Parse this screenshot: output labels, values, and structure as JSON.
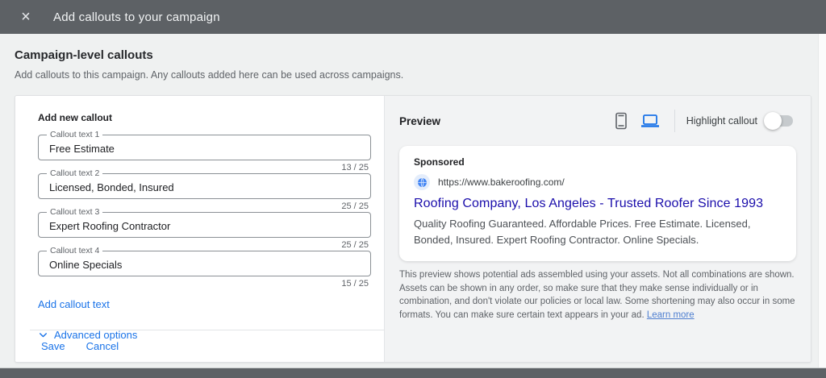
{
  "modal": {
    "title": "Add callouts to your campaign"
  },
  "page": {
    "heading": "Campaign-level callouts",
    "subheading": "Add callouts to this campaign. Any callouts added here can be used across campaigns."
  },
  "form": {
    "title": "Add new callout",
    "fields": [
      {
        "label": "Callout text 1",
        "value": "Free Estimate",
        "counter": "13 / 25"
      },
      {
        "label": "Callout text 2",
        "value": "Licensed, Bonded, Insured",
        "counter": "25 / 25"
      },
      {
        "label": "Callout text 3",
        "value": "Expert Roofing Contractor",
        "counter": "25 / 25"
      },
      {
        "label": "Callout text 4",
        "value": "Online Specials",
        "counter": "15 / 25"
      }
    ],
    "add_callout_label": "Add callout text",
    "advanced_options_label": "Advanced options",
    "save_label": "Save",
    "cancel_label": "Cancel"
  },
  "preview": {
    "title": "Preview",
    "highlight_label": "Highlight callout",
    "toggle_state": "off",
    "ad": {
      "sponsored": "Sponsored",
      "url": "https://www.bakeroofing.com/",
      "headline": "Roofing Company, Los Angeles - Trusted Roofer Since 1993",
      "description": "Quality Roofing Guaranteed. Affordable Prices. Free Estimate. Licensed, Bonded, Insured. Expert Roofing Contractor. Online Specials."
    },
    "disclaimer_text": "This preview shows potential ads assembled using your assets. Not all combinations are shown. Assets can be shown in any order, so make sure that they make sense individually or in combination, and don't violate our policies or local law. Some shortening may also occur in some formats. You can make sure certain text appears in your ad. ",
    "learn_more_label": "Learn more"
  },
  "icons": {
    "close": "close-icon",
    "chevron_down": "chevron-down-icon",
    "mobile": "mobile-preview-icon",
    "desktop": "desktop-preview-icon",
    "globe": "globe-favicon-icon"
  },
  "colors": {
    "topbar_gray": "#5d6165",
    "accent_blue": "#1a73e8",
    "headline_blue": "#1a0dab",
    "text_dark": "#202124",
    "text_gray": "#5f6368",
    "panel_gray": "#f2f3f4"
  }
}
